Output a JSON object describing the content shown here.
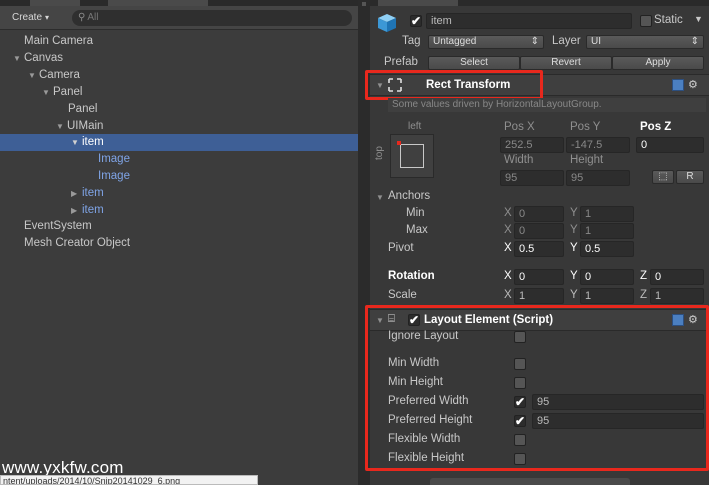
{
  "hierarchy": {
    "create_label": "Create",
    "search_placeholder": "All",
    "items": [
      {
        "label": "Main Camera"
      },
      {
        "label": "Canvas"
      },
      {
        "label": "Camera"
      },
      {
        "label": "Panel"
      },
      {
        "label": "Panel"
      },
      {
        "label": "UIMain"
      },
      {
        "label": "item"
      },
      {
        "label": "Image"
      },
      {
        "label": "Image"
      },
      {
        "label": "item"
      },
      {
        "label": "item"
      },
      {
        "label": "EventSystem"
      },
      {
        "label": "Mesh Creator Object"
      }
    ]
  },
  "overlay": {
    "watermark": "www.yxkfw.com",
    "url_tooltip": "ntent/uploads/2014/10/Snip20141029_6.png"
  },
  "inspector": {
    "object_name": "item",
    "static_label": "Static",
    "tag_label": "Tag",
    "tag_value": "Untagged",
    "layer_label": "Layer",
    "layer_value": "UI",
    "prefab_label": "Prefab",
    "prefab_buttons": [
      "Select",
      "Revert",
      "Apply"
    ],
    "rect_transform": {
      "title": "Rect Transform",
      "driven_note": "Some values driven by HorizontalLayoutGroup.",
      "anchor_preset_h": "left",
      "anchor_preset_v": "top",
      "pos_x_label": "Pos X",
      "pos_y_label": "Pos Y",
      "pos_z_label": "Pos Z",
      "pos_x": "252.5",
      "pos_y": "-147.5",
      "pos_z": "0",
      "width_label": "Width",
      "height_label": "Height",
      "width": "95",
      "height": "95",
      "r_button": "R",
      "anchors_label": "Anchors",
      "min_label": "Min",
      "max_label": "Max",
      "min_x": "0",
      "min_y": "1",
      "max_x": "0",
      "max_y": "1",
      "pivot_label": "Pivot",
      "pivot_x": "0.5",
      "pivot_y": "0.5",
      "rotation_label": "Rotation",
      "rot_x": "0",
      "rot_y": "0",
      "rot_z": "0",
      "scale_label": "Scale",
      "scale_x": "1",
      "scale_y": "1",
      "scale_z": "1",
      "axis_x": "X",
      "axis_y": "Y",
      "axis_z": "Z"
    },
    "layout_element": {
      "title": "Layout Element (Script)",
      "ignore_layout": "Ignore Layout",
      "min_width": "Min Width",
      "min_height": "Min Height",
      "preferred_width": "Preferred Width",
      "preferred_width_value": "95",
      "preferred_height": "Preferred Height",
      "preferred_height_value": "95",
      "flexible_width": "Flexible Width",
      "flexible_height": "Flexible Height"
    }
  },
  "colors": {
    "selection": "#3e5f96",
    "highlight_box": "#e8281d",
    "prefab_link": "#7fa4e6"
  }
}
